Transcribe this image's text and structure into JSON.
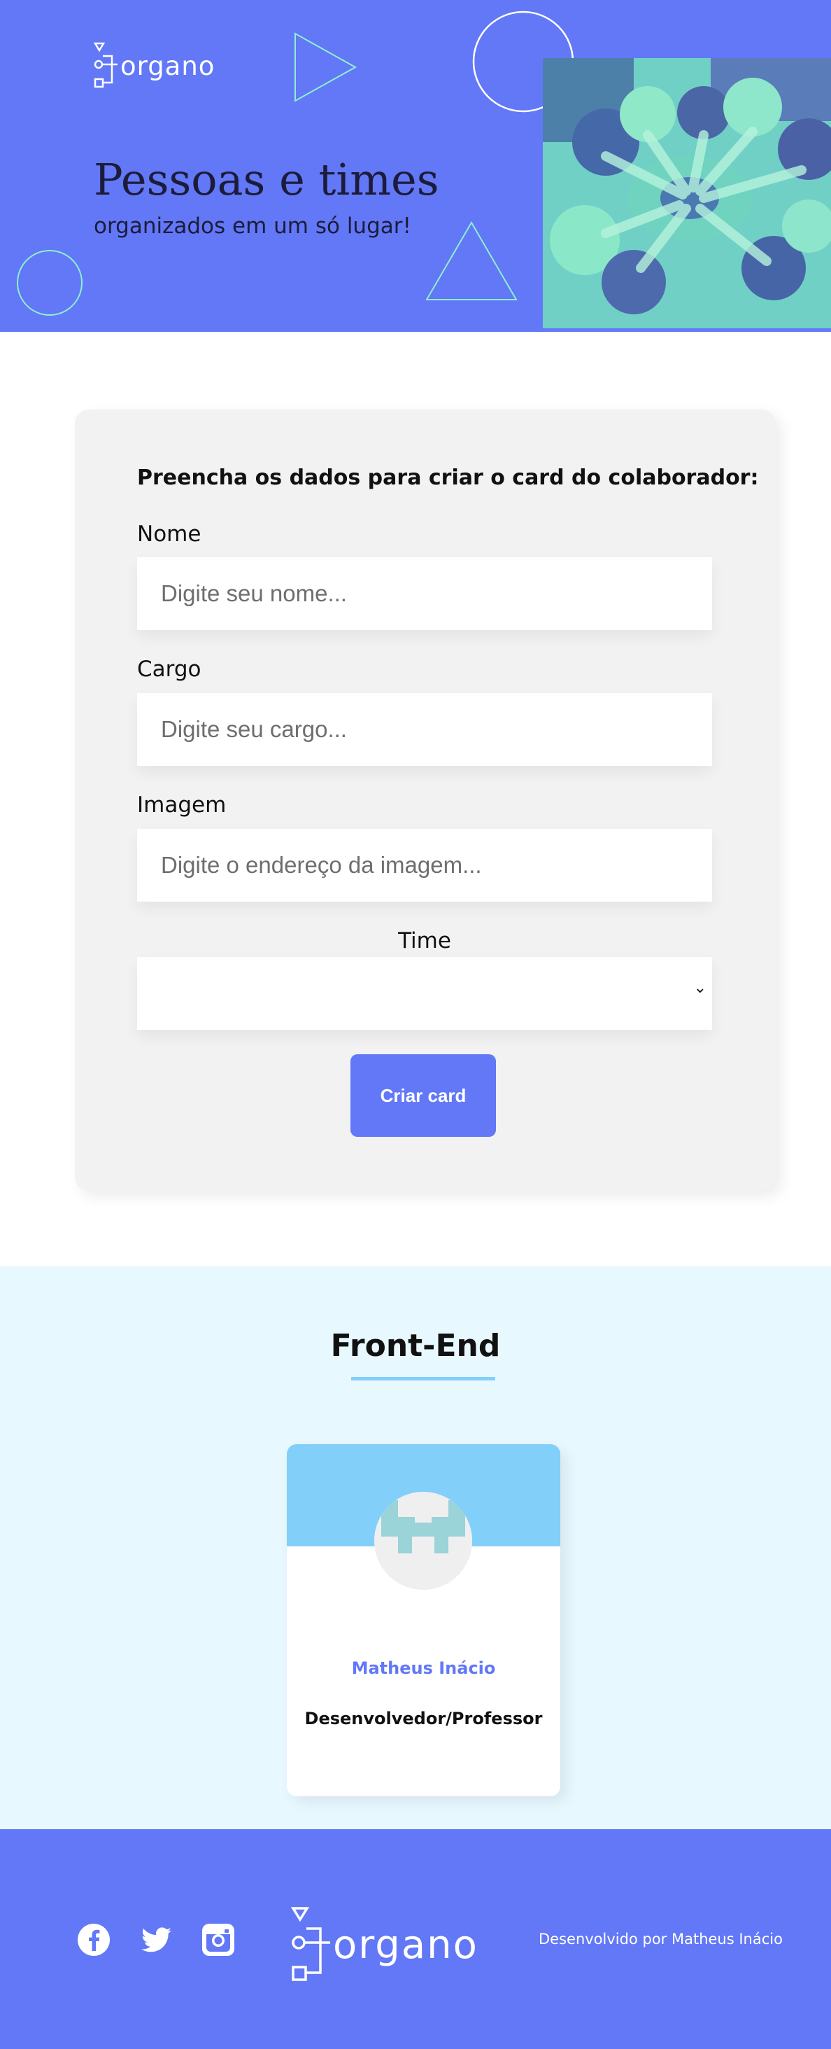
{
  "banner": {
    "logo_text": "organo",
    "title": "Pessoas e times",
    "subtitle": "organizados em um só lugar!",
    "icons": [
      "organo-logo-icon",
      "triangle-outline",
      "circle-outline",
      "team-photo"
    ]
  },
  "form": {
    "heading": "Preencha os dados para criar o card do colaborador:",
    "fields": [
      {
        "label": "Nome",
        "placeholder": "Digite seu nome...",
        "value": ""
      },
      {
        "label": "Cargo",
        "placeholder": "Digite seu cargo...",
        "value": ""
      },
      {
        "label": "Imagem",
        "placeholder": "Digite o endereço da imagem...",
        "value": ""
      }
    ],
    "select": {
      "label": "Time",
      "selected": ""
    },
    "submit_label": "Criar card"
  },
  "teams": [
    {
      "name": "Front-End",
      "primary_color": "#82CFFA",
      "secondary_color": "#E8F8FF",
      "members": [
        {
          "name": "Matheus Inácio",
          "role": "Desenvolvedor/Professor"
        }
      ]
    }
  ],
  "footer": {
    "social_icons": [
      "facebook-icon",
      "twitter-icon",
      "instagram-icon"
    ],
    "logo_text": "organo",
    "credit": "Desenvolvido por Matheus Inácio"
  },
  "colors": {
    "brand": "#6278F7",
    "form_background": "#F2F2F2",
    "team_primary": "#82CFFA",
    "team_background": "#E8F8FF"
  }
}
